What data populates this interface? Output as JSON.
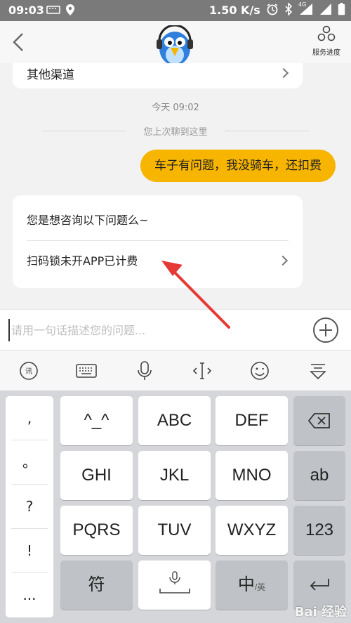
{
  "status_bar": {
    "time": "09:03",
    "speed": "1.50 K/s",
    "network": "4G"
  },
  "header": {
    "progress_label": "服务进度"
  },
  "chat": {
    "prev_card_label": "其他渠道",
    "timestamp": "今天 09:02",
    "history_divider": "您上次聊到这里",
    "user_message": "车子有问题，我没骑车，还扣费",
    "question_title": "您是想咨询以下问题么~",
    "question_item": "扫码锁未开APP已计费"
  },
  "input": {
    "placeholder": "请用一句话描述您的问题..."
  },
  "keyboard": {
    "punctuation": [
      ",",
      "。",
      "?",
      "!",
      "..."
    ],
    "rows": [
      [
        "^_^",
        "ABC",
        "DEF"
      ],
      [
        "GHI",
        "JKL",
        "MNO"
      ],
      [
        "PQRS",
        "TUV",
        "WXYZ"
      ]
    ],
    "fn_ab": "ab",
    "fn_123": "123",
    "symbols_key": "符",
    "lang_key_main": "中",
    "lang_key_sub": "/英"
  },
  "watermark": "Bai 经验",
  "colors": {
    "accent": "#f7b500",
    "annotation_arrow": "#e53935",
    "status_bar": "#7a7a7a"
  }
}
